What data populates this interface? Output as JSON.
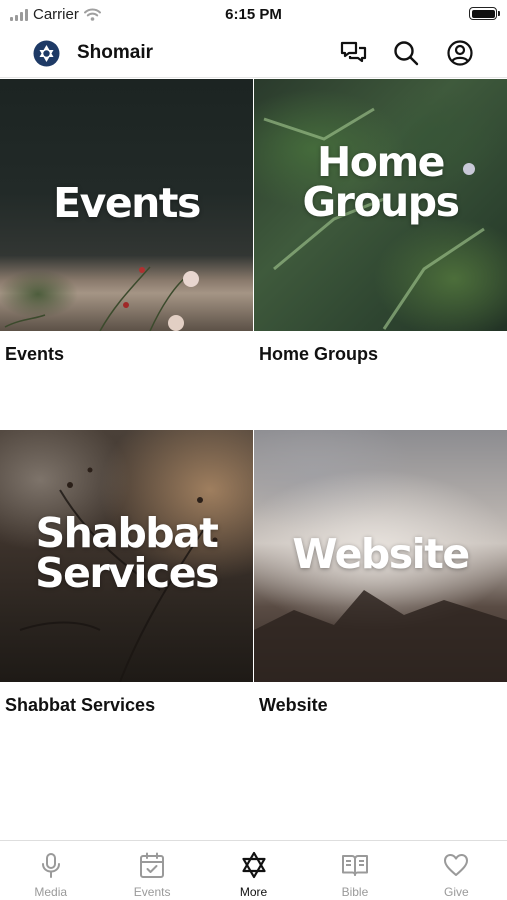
{
  "status_bar": {
    "carrier": "Carrier",
    "time": "6:15 PM"
  },
  "header": {
    "title": "Shomair",
    "logo_icon": "star-of-david-icon"
  },
  "tiles": [
    {
      "image_text_lines": [
        "Events"
      ],
      "label": "Events"
    },
    {
      "image_text_lines": [
        "Home",
        "Groups"
      ],
      "label": "Home Groups"
    },
    {
      "image_text_lines": [
        "Shabbat",
        "Services"
      ],
      "label": "Shabbat Services"
    },
    {
      "image_text_lines": [
        "Website"
      ],
      "label": "Website"
    }
  ],
  "tab_bar": {
    "active": "More",
    "tabs": [
      {
        "label": "Media",
        "icon": "microphone-icon"
      },
      {
        "label": "Events",
        "icon": "calendar-check-icon"
      },
      {
        "label": "More",
        "icon": "star-of-david-icon"
      },
      {
        "label": "Bible",
        "icon": "open-book-icon"
      },
      {
        "label": "Give",
        "icon": "heart-icon"
      }
    ]
  },
  "colors": {
    "brand": "#1e3a66",
    "active": "#111111",
    "inactive": "#9a9a9a"
  }
}
